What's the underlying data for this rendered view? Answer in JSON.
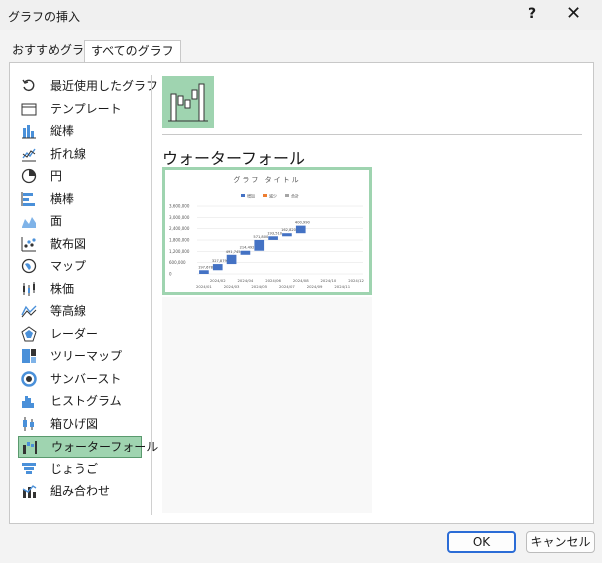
{
  "window": {
    "title": "グラフの挿入",
    "help": "?",
    "close": "✕"
  },
  "tabs": [
    "おすすめグラフ",
    "すべてのグラフ"
  ],
  "sidebar": {
    "items": [
      {
        "label": "最近使用したグラフ",
        "icon": "recent-icon"
      },
      {
        "label": "テンプレート",
        "icon": "template-icon"
      },
      {
        "label": "縦棒",
        "icon": "column-chart-icon"
      },
      {
        "label": "折れ線",
        "icon": "line-chart-icon"
      },
      {
        "label": "円",
        "icon": "pie-chart-icon"
      },
      {
        "label": "横棒",
        "icon": "bar-chart-icon"
      },
      {
        "label": "面",
        "icon": "area-chart-icon"
      },
      {
        "label": "散布図",
        "icon": "scatter-chart-icon"
      },
      {
        "label": "マップ",
        "icon": "map-chart-icon"
      },
      {
        "label": "株価",
        "icon": "stock-chart-icon"
      },
      {
        "label": "等高線",
        "icon": "surface-chart-icon"
      },
      {
        "label": "レーダー",
        "icon": "radar-chart-icon"
      },
      {
        "label": "ツリーマップ",
        "icon": "treemap-chart-icon"
      },
      {
        "label": "サンバースト",
        "icon": "sunburst-chart-icon"
      },
      {
        "label": "ヒストグラム",
        "icon": "histogram-chart-icon"
      },
      {
        "label": "箱ひげ図",
        "icon": "boxwhisker-chart-icon"
      },
      {
        "label": "ウォーターフォール",
        "icon": "waterfall-chart-icon"
      },
      {
        "label": "じょうご",
        "icon": "funnel-chart-icon"
      },
      {
        "label": "組み合わせ",
        "icon": "combo-chart-icon"
      }
    ],
    "selected_index": 16
  },
  "main": {
    "subtype_icon": "waterfall-chart-icon",
    "section_title": "ウォーターフォール"
  },
  "preview": {
    "chart_data": {
      "type": "bar",
      "subtype": "waterfall",
      "title": "グラフ タイトル",
      "legend": [
        "増加",
        "減少",
        "合計"
      ],
      "legend_position": "top",
      "y_ticks": [
        "3,600,000",
        "3,000,000",
        "2,400,000",
        "1,800,000",
        "1,200,000",
        "600,000",
        "0"
      ],
      "ylim": [
        0,
        3600000
      ],
      "x_ticks_top": [
        "2024/02",
        "2024/04",
        "2024/06",
        "2024/08",
        "2024/10",
        "2024/12"
      ],
      "x_ticks_bottom": [
        "2024/01",
        "2024/03",
        "2024/05",
        "2024/07",
        "2024/09",
        "2024/11"
      ],
      "categories": [
        "2024/01",
        "2024/02",
        "2024/03",
        "2024/04",
        "2024/05",
        "2024/06",
        "2024/07",
        "2024/08",
        "2024/09",
        "2024/10",
        "2024/11",
        "2024/12"
      ],
      "values": [
        197678,
        327879,
        491745,
        214492,
        571800,
        193510,
        162820,
        400990,
        0,
        0,
        0,
        0
      ],
      "data_labels": [
        "197,678",
        "327,879",
        "491,745",
        "214,492",
        "571,800",
        "193,510",
        "162,820",
        "400,990"
      ],
      "colors": {
        "increase": "#4472c4",
        "decrease": "#ed7d31",
        "total": "#a5a5a5",
        "grid": "#e0e0e0"
      }
    }
  },
  "buttons": {
    "ok": "OK",
    "cancel": "キャンセル"
  }
}
